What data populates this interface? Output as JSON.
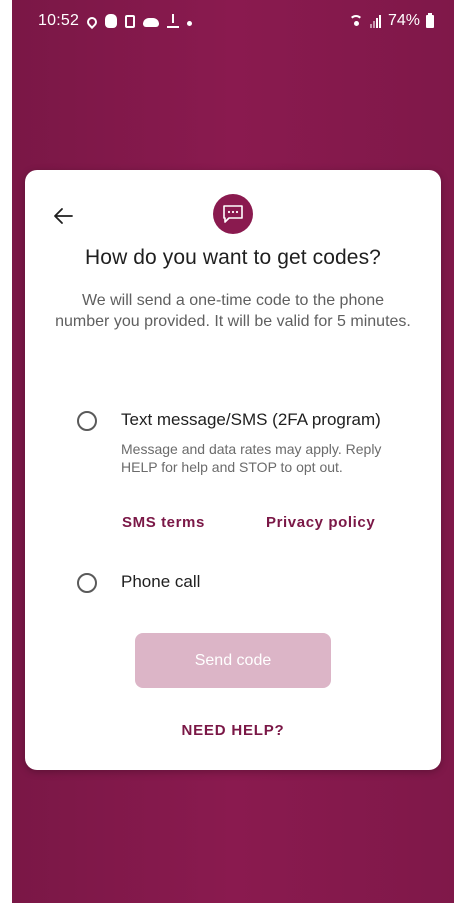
{
  "status_bar": {
    "time": "10:52",
    "battery": "74%"
  },
  "dialog": {
    "title": "How do you want to get codes?",
    "subtitle": "We will send a one-time code to the phone number you provided. It will be valid for 5 minutes.",
    "options": [
      {
        "label": "Text message/SMS (2FA program)",
        "description": "Message and data rates may apply. Reply HELP for help and STOP to opt out.",
        "selected": false
      },
      {
        "label": "Phone call",
        "selected": false
      }
    ],
    "links": {
      "sms_terms": "SMS terms",
      "privacy_policy": "Privacy policy"
    },
    "send_button": "Send code",
    "help_link": "NEED HELP?"
  },
  "colors": {
    "brand": "#8a1a4f",
    "button_disabled": "#dcb5c7",
    "link": "#7a1746"
  }
}
